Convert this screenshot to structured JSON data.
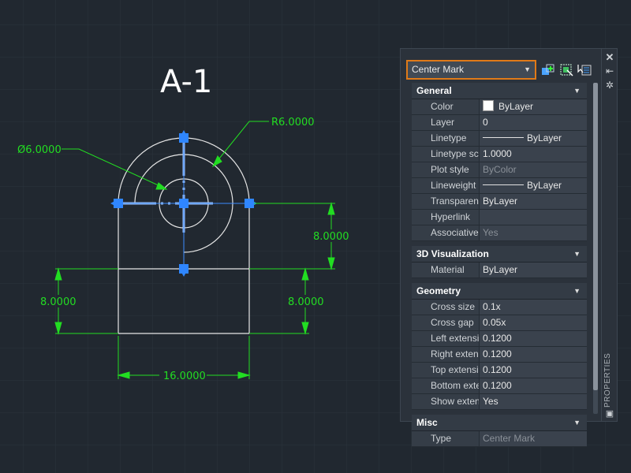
{
  "drawing": {
    "title": "A-1",
    "dim_radius": "R6.0000",
    "dim_diameter": "Ø6.0000",
    "dim_right_vertical": "8.0000",
    "dim_left_lower": "8.0000",
    "dim_right_lower": "8.0000",
    "dim_width": "16.0000"
  },
  "palette": {
    "selected_object": "Center Mark",
    "icons": [
      "quick-select-icon",
      "select-objects-icon",
      "toggle-pickadd-icon"
    ],
    "categories": [
      {
        "name": "General",
        "rows": [
          {
            "name": "Color",
            "value": "ByLayer",
            "kind": "color"
          },
          {
            "name": "Layer",
            "value": "0"
          },
          {
            "name": "Linetype",
            "value": "ByLayer",
            "kind": "line"
          },
          {
            "name": "Linetype scale",
            "value": "1.0000"
          },
          {
            "name": "Plot style",
            "value": "ByColor",
            "dim": true
          },
          {
            "name": "Lineweight",
            "value": "ByLayer",
            "kind": "line"
          },
          {
            "name": "Transparency",
            "value": "ByLayer"
          },
          {
            "name": "Hyperlink",
            "value": ""
          },
          {
            "name": "Associative",
            "value": "Yes",
            "dim": true
          }
        ]
      },
      {
        "name": "3D Visualization",
        "rows": [
          {
            "name": "Material",
            "value": "ByLayer"
          }
        ]
      },
      {
        "name": "Geometry",
        "rows": [
          {
            "name": "Cross size",
            "value": "0.1x"
          },
          {
            "name": "Cross gap",
            "value": "0.05x"
          },
          {
            "name": "Left extension",
            "value": "0.1200"
          },
          {
            "name": "Right extensi...",
            "value": "0.1200"
          },
          {
            "name": "Top extension",
            "value": "0.1200"
          },
          {
            "name": "Bottom exte...",
            "value": "0.1200"
          },
          {
            "name": "Show extensi...",
            "value": "Yes"
          }
        ]
      },
      {
        "name": "Misc",
        "rows": [
          {
            "name": "Type",
            "value": "Center Mark",
            "dim": true
          }
        ]
      }
    ]
  },
  "strip": {
    "label": "PROPERTIES"
  },
  "colors": {
    "background": "#212830",
    "geometry": "#e6e6e6",
    "dimension": "#22dd22",
    "selection": "#3c8cff",
    "highlight": "#e07a18"
  }
}
